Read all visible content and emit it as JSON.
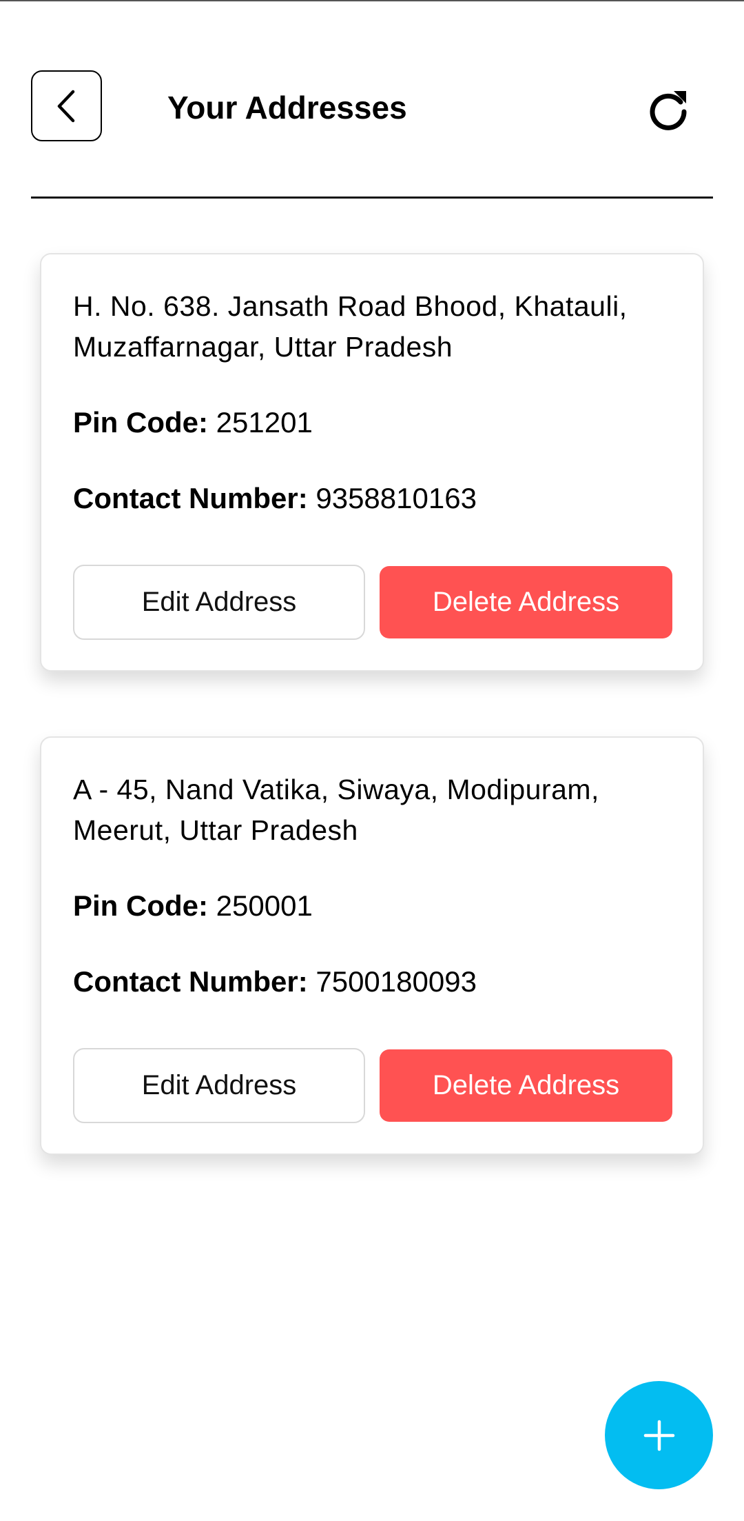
{
  "header": {
    "title": "Your Addresses",
    "back_icon": "chevron-left-icon",
    "refresh_icon": "refresh-icon"
  },
  "addresses": [
    {
      "address": "H. No. 638. Jansath Road Bhood, Khatauli, Muzaffarnagar, Uttar Pradesh",
      "pin_label": "Pin Code:",
      "pin_value": "251201",
      "contact_label": "Contact Number:",
      "contact_value": "9358810163",
      "edit_label": "Edit Address",
      "delete_label": "Delete Address"
    },
    {
      "address": "A - 45, Nand Vatika, Siwaya, Modipuram, Meerut, Uttar Pradesh",
      "pin_label": "Pin Code:",
      "pin_value": "250001",
      "contact_label": "Contact Number:",
      "contact_value": "7500180093",
      "edit_label": "Edit Address",
      "delete_label": "Delete Address"
    }
  ],
  "fab": {
    "icon": "plus-icon"
  },
  "colors": {
    "delete_button": "#ff5252",
    "fab": "#03bdf1",
    "text": "#000000"
  }
}
